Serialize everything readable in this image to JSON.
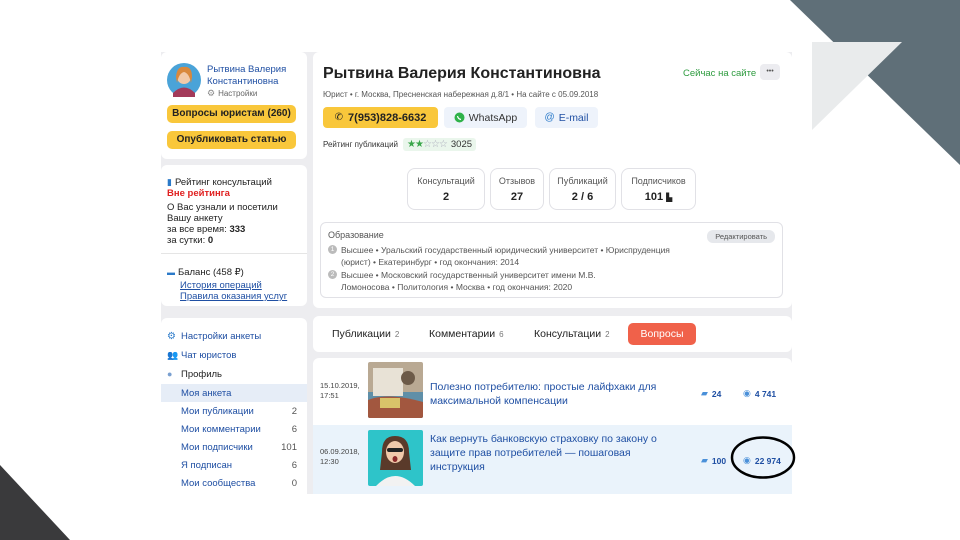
{
  "colors": {
    "accent": "#f9c73b",
    "brand_blue": "#1f4fa3",
    "alert_red": "#e02020",
    "online_green": "#2e9b3f",
    "active_tab": "#f0614a",
    "deco_gray": "#5f6f78"
  },
  "sidebar": {
    "user_name": "Рытвина Валерия Константиновна",
    "settings_label": "Настройки",
    "questions_button": "Вопросы юристам (260)",
    "publish_button": "Опубликовать статью",
    "rating_title": "Рейтинг консультаций",
    "rating_status": "Вне рейтинга",
    "visits_text": "О Вас узнали и посетили Вашу анкету",
    "visits_total_label": "за все время:",
    "visits_total": "333",
    "visits_day_label": "за сутки:",
    "visits_day": "0",
    "balance_label": "Баланс (458 ₽)",
    "history_link": "История операций",
    "rules_link": "Правила оказания услуг",
    "menu": {
      "profile_settings": "Настройки анкеты",
      "lawyers_chat": "Чат юристов",
      "profile": "Профиль",
      "items": [
        {
          "label": "Моя анкета",
          "count": ""
        },
        {
          "label": "Мои публикации",
          "count": "2"
        },
        {
          "label": "Мои комментарии",
          "count": "6"
        },
        {
          "label": "Мои подписчики",
          "count": "101"
        },
        {
          "label": "Я подписан",
          "count": "6"
        },
        {
          "label": "Мои сообщества",
          "count": "0"
        }
      ]
    }
  },
  "profile": {
    "name": "Рытвина Валерия Константиновна",
    "online_status": "Сейчас на сайте",
    "more_button": "•••",
    "subtitle": "Юрист • г. Москва, Пресненская набережная д.8/1 • На сайте с 05.09.2018",
    "phone": "7(953)828-6632",
    "whatsapp": "WhatsApp",
    "email": "E-mail",
    "rating_label": "Рейтинг публикаций",
    "rating_value": "3025",
    "rating_stars": 2,
    "stats": [
      {
        "label": "Консультаций",
        "value": "2"
      },
      {
        "label": "Отзывов",
        "value": "27"
      },
      {
        "label": "Публикаций",
        "value": "2 / 6"
      },
      {
        "label": "Подписчиков",
        "value": "101"
      }
    ],
    "education": {
      "title": "Образование",
      "edit_button": "Редактировать",
      "entries": [
        {
          "num": "1",
          "line1": "Высшее • Уральский государственный юридический университет • Юриспруденция",
          "line2": "(юрист) • Екатеринбург • год окончания: 2014"
        },
        {
          "num": "2",
          "line1": "Высшее • Московский государственный университет имени М.В.",
          "line2": "Ломоносова • Политология • Москва • год окончания: 2020"
        }
      ]
    }
  },
  "tabs": [
    {
      "label": "Публикации",
      "count": "2"
    },
    {
      "label": "Комментарии",
      "count": "6"
    },
    {
      "label": "Консультации",
      "count": "2"
    },
    {
      "label": "Вопросы",
      "count": ""
    }
  ],
  "posts": [
    {
      "date": "15.10.2019,",
      "time": "17:51",
      "title": "Полезно потребителю: простые лайфхаки для максимальной компенсации",
      "comments": "24",
      "views": "4 741"
    },
    {
      "date": "06.09.2018,",
      "time": "12:30",
      "title": "Как вернуть банковскую страховку по закону о защите прав потребителей — пошаговая инструкция",
      "comments": "100",
      "views": "22 974"
    }
  ]
}
